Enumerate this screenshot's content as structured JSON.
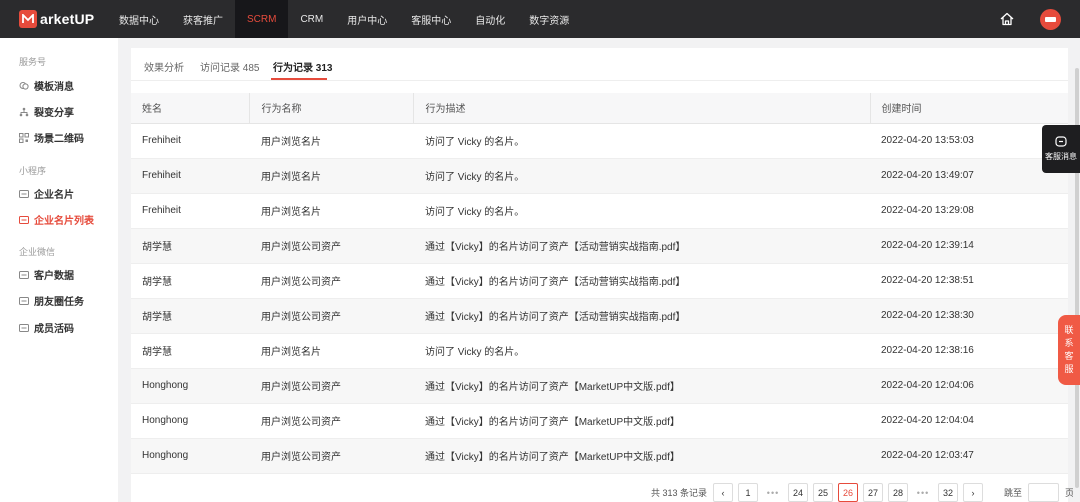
{
  "brand": {
    "logo_text": "arketUP",
    "logo_letter": "M"
  },
  "nav": {
    "items": [
      "数据中心",
      "获客推广",
      "SCRM",
      "CRM",
      "用户中心",
      "客服中心",
      "自动化",
      "数字资源"
    ],
    "active_index": 2,
    "accent": "#e64b3c"
  },
  "sidebar": {
    "group1": "服务号",
    "item_template_msg": "模板消息",
    "item_fission_share": "裂变分享",
    "item_scene_qr": "场景二维码",
    "group2": "小程序",
    "item_company_card": "企业名片",
    "item_company_card_list": "企业名片列表",
    "group3": "企业微信",
    "item_customer_data": "客户数据",
    "item_moments_task": "朋友圈任务",
    "item_member_qr": "成员活码"
  },
  "tabs": {
    "effect_analysis": "效果分析",
    "visit_records": "访问记录 485",
    "behavior_records": "行为记录 313"
  },
  "table": {
    "headers": {
      "name": "姓名",
      "action_name": "行为名称",
      "action_desc": "行为描述",
      "created": "创建时间"
    },
    "rows": [
      {
        "name": "Frehiheit",
        "action": "用户浏览名片",
        "desc": "访问了 Vicky 的名片。",
        "time": "2022-04-20 13:53:03"
      },
      {
        "name": "Frehiheit",
        "action": "用户浏览名片",
        "desc": "访问了 Vicky 的名片。",
        "time": "2022-04-20 13:49:07"
      },
      {
        "name": "Frehiheit",
        "action": "用户浏览名片",
        "desc": "访问了 Vicky 的名片。",
        "time": "2022-04-20 13:29:08"
      },
      {
        "name": "胡学慧",
        "action": "用户浏览公司资产",
        "desc": "通过【Vicky】的名片访问了资产【活动营销实战指南.pdf】",
        "time": "2022-04-20 12:39:14"
      },
      {
        "name": "胡学慧",
        "action": "用户浏览公司资产",
        "desc": "通过【Vicky】的名片访问了资产【活动营销实战指南.pdf】",
        "time": "2022-04-20 12:38:51"
      },
      {
        "name": "胡学慧",
        "action": "用户浏览公司资产",
        "desc": "通过【Vicky】的名片访问了资产【活动营销实战指南.pdf】",
        "time": "2022-04-20 12:38:30"
      },
      {
        "name": "胡学慧",
        "action": "用户浏览名片",
        "desc": "访问了 Vicky 的名片。",
        "time": "2022-04-20 12:38:16"
      },
      {
        "name": "Honghong",
        "action": "用户浏览公司资产",
        "desc": "通过【Vicky】的名片访问了资产【MarketUP中文版.pdf】",
        "time": "2022-04-20 12:04:06"
      },
      {
        "name": "Honghong",
        "action": "用户浏览公司资产",
        "desc": "通过【Vicky】的名片访问了资产【MarketUP中文版.pdf】",
        "time": "2022-04-20 12:04:04"
      },
      {
        "name": "Honghong",
        "action": "用户浏览公司资产",
        "desc": "通过【Vicky】的名片访问了资产【MarketUP中文版.pdf】",
        "time": "2022-04-20 12:03:47"
      }
    ]
  },
  "pagination": {
    "total_text": "共 313 条记录",
    "prev": "‹",
    "p1": "1",
    "p24": "24",
    "p25": "25",
    "p26": "26",
    "p27": "27",
    "p28": "28",
    "p32": "32",
    "next": "›",
    "dots": "•••",
    "jump_label": "跳至",
    "page_suffix": "页"
  },
  "floating": {
    "service_msg": "客服消息",
    "contact": [
      "联",
      "系",
      "客",
      "服"
    ]
  }
}
